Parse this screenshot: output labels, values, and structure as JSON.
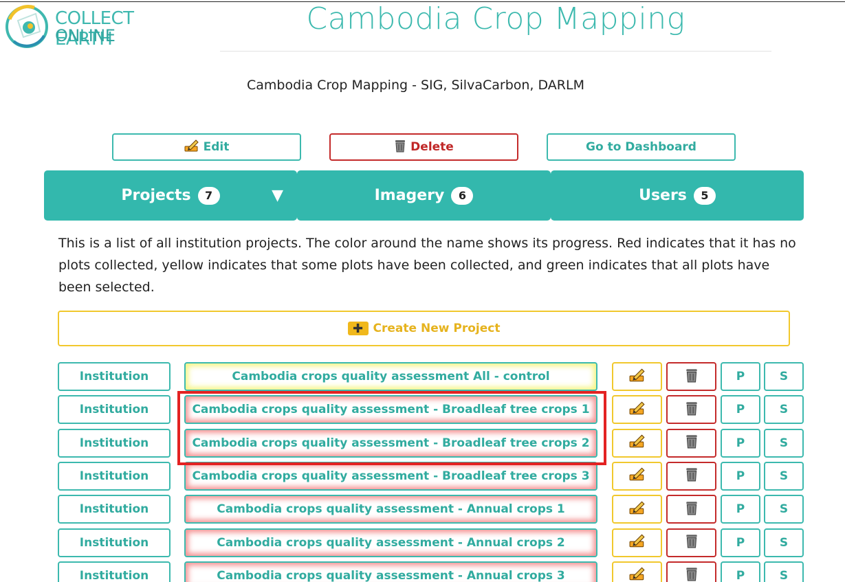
{
  "logo": {
    "line1": "COLLECT EARTH",
    "line2": "ONLINE"
  },
  "page_title": "Cambodia Crop Mapping",
  "institution_description": "Cambodia Crop Mapping - SIG, SilvaCarbon, DARLM",
  "actions": {
    "edit_label": "Edit",
    "delete_label": "Delete",
    "dashboard_label": "Go to Dashboard"
  },
  "tabs": [
    {
      "label": "Projects",
      "count": "7",
      "expanded": true
    },
    {
      "label": "Imagery",
      "count": "6"
    },
    {
      "label": "Users",
      "count": "5"
    }
  ],
  "intro_text": "This is a list of all institution projects. The color around the name shows its progress. Red indicates that it has no plots collected, yellow indicates that some plots have been collected, and green indicates that all plots have been selected.",
  "create_project_label": "Create New Project",
  "colors": {
    "accent": "#3cb9ae",
    "danger": "#c42a2a",
    "warning": "#f1c82d",
    "highlight": "#e32222"
  },
  "projects": [
    {
      "institution_label": "Institution",
      "name": "Cambodia crops quality assessment All - control",
      "progress": "yellow",
      "p_label": "P",
      "s_label": "S"
    },
    {
      "institution_label": "Institution",
      "name": "Cambodia crops quality assessment - Broadleaf tree crops 1",
      "progress": "red",
      "p_label": "P",
      "s_label": "S"
    },
    {
      "institution_label": "Institution",
      "name": "Cambodia crops quality assessment - Broadleaf tree crops 2",
      "progress": "red",
      "p_label": "P",
      "s_label": "S"
    },
    {
      "institution_label": "Institution",
      "name": "Cambodia crops quality assessment - Broadleaf tree crops 3",
      "progress": "red",
      "p_label": "P",
      "s_label": "S"
    },
    {
      "institution_label": "Institution",
      "name": "Cambodia crops quality assessment - Annual crops 1",
      "progress": "red",
      "p_label": "P",
      "s_label": "S"
    },
    {
      "institution_label": "Institution",
      "name": "Cambodia crops quality assessment - Annual crops 2",
      "progress": "red",
      "p_label": "P",
      "s_label": "S"
    },
    {
      "institution_label": "Institution",
      "name": "Cambodia crops quality assessment - Annual crops 3",
      "progress": "red",
      "p_label": "P",
      "s_label": "S"
    }
  ]
}
